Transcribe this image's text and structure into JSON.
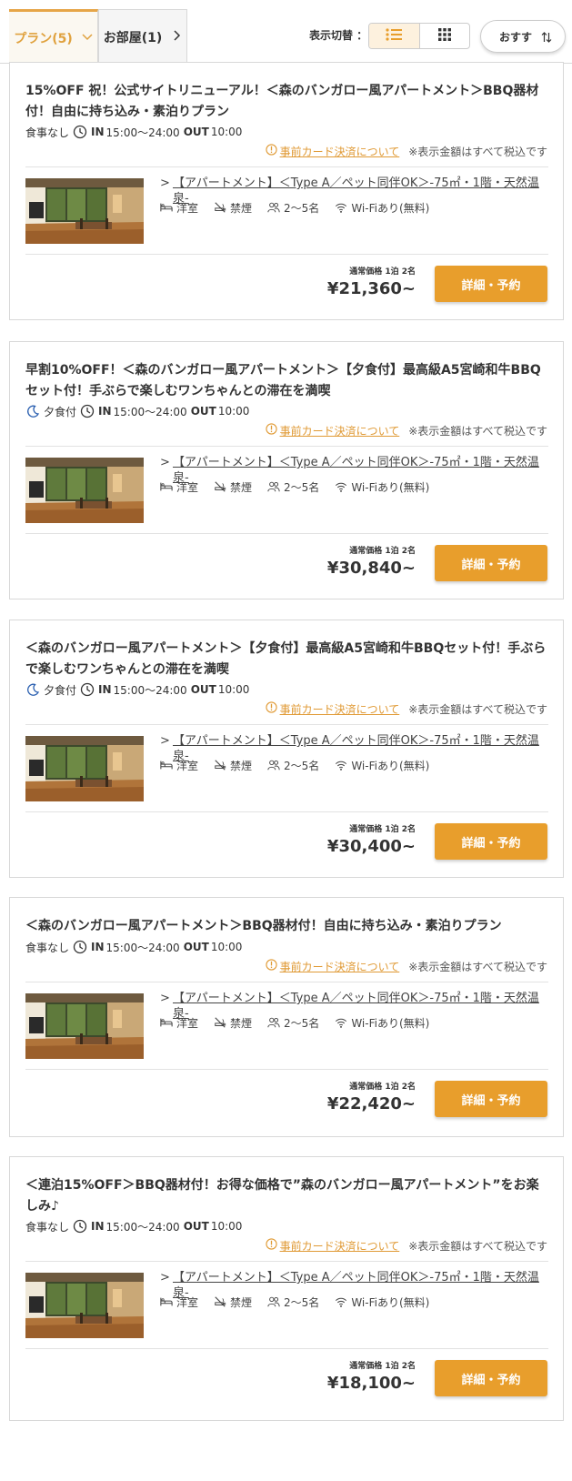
{
  "tabs": {
    "plans_label": "プラン(5)",
    "rooms_label": "お部屋(1)"
  },
  "view": {
    "label": "表示切替 ："
  },
  "sort": {
    "label": "おすす"
  },
  "colors": {
    "accent": "#e89e2c",
    "link": "#e09a35",
    "border": "#d8d8d8"
  },
  "common": {
    "card_notice": "事前カード決済について",
    "tax_note": "※表示金額はすべて税込です",
    "room_name": "【アパートメント】＜Type A／ペット同伴OK＞-75㎡・1階・天然温泉-",
    "room_chevron": ">",
    "features": {
      "bed": "洋室",
      "smoking": "禁煙",
      "capacity": "2～5名",
      "wifi": "Wi-Fiあり(無料)"
    },
    "price_label": "通常価格 1泊 2名",
    "book_label": "詳細・予約",
    "in_label": "IN",
    "in_time": "15:00～24:00",
    "out_label": "OUT",
    "out_time": "10:00"
  },
  "plans": [
    {
      "title": "15%OFF 祝！公式サイトリニューアル！＜森のバンガロー風アパートメント＞BBQ器材付！自由に持ち込み・素泊りプラン",
      "meal": "食事なし",
      "meal_icon": "none",
      "price": "¥21,360~"
    },
    {
      "title": "早割10%OFF！＜森のバンガロー風アパートメント＞【夕食付】最高級A5宮崎和牛BBQセット付！手ぶらで楽しむワンちゃんとの滞在を満喫",
      "meal": "夕食付",
      "meal_icon": "moon-icon",
      "price": "¥30,840~"
    },
    {
      "title": "＜森のバンガロー風アパートメント＞【夕食付】最高級A5宮崎和牛BBQセット付！手ぶらで楽しむワンちゃんとの滞在を満喫",
      "meal": "夕食付",
      "meal_icon": "moon-icon",
      "price": "¥30,400~"
    },
    {
      "title": "＜森のバンガロー風アパートメント＞BBQ器材付！自由に持ち込み・素泊りプラン",
      "meal": "食事なし",
      "meal_icon": "none",
      "price": "¥22,420~"
    },
    {
      "title": "＜連泊15%OFF＞BBQ器材付！お得な価格で”森のバンガロー風アパートメント”をお楽しみ♪",
      "meal": "食事なし",
      "meal_icon": "none",
      "price": "¥18,100~"
    }
  ]
}
